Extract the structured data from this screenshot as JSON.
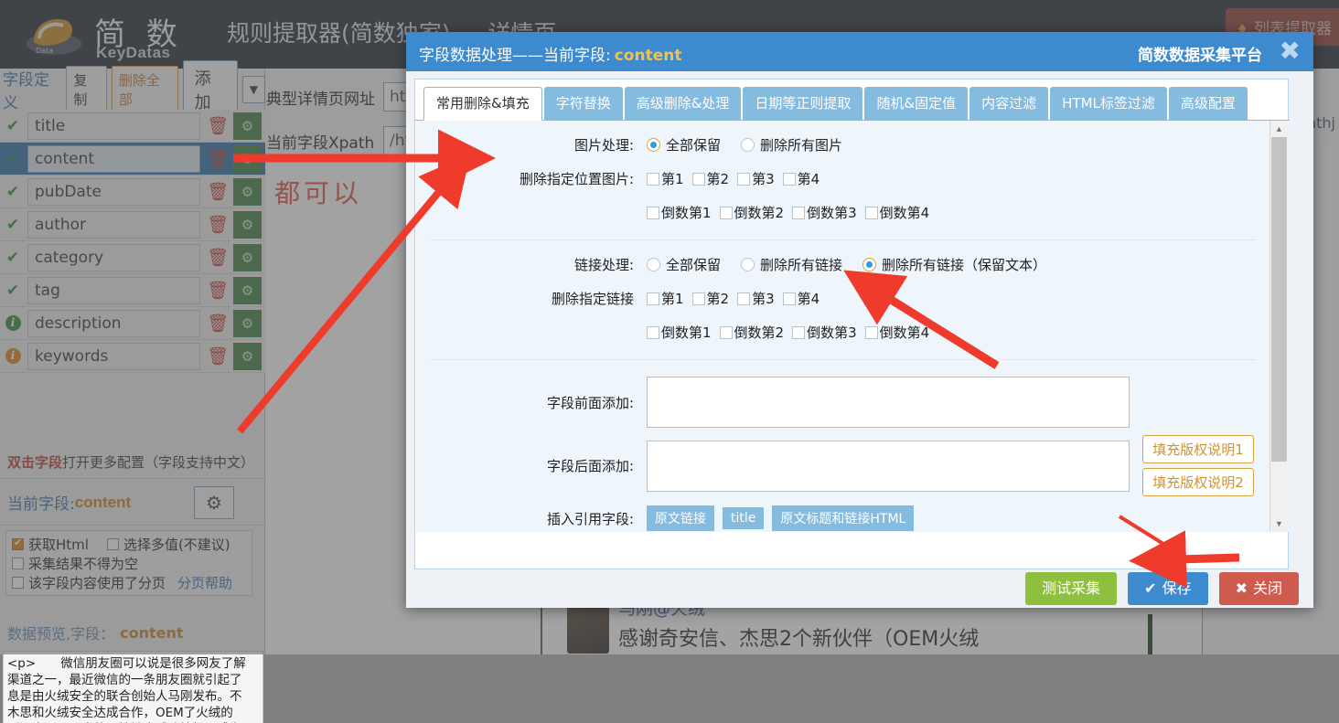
{
  "app": {
    "logo_cn": "简 数",
    "logo_en": "KeyDatas",
    "title": "规则提取器(简数独家) — 详情页",
    "list_extractor_button": "列表提取器",
    "flame_icon": "flame-icon"
  },
  "left_panel": {
    "toolbar": {
      "label": "字段定义",
      "copy": "复制",
      "delete_all": "删除全部",
      "add": "添加",
      "caret": "▼"
    },
    "fields": [
      {
        "state": "ok",
        "name": "title",
        "selected": false
      },
      {
        "state": "ok",
        "name": "content",
        "selected": true
      },
      {
        "state": "ok",
        "name": "pubDate",
        "selected": false
      },
      {
        "state": "ok",
        "name": "author",
        "selected": false
      },
      {
        "state": "ok",
        "name": "category",
        "selected": false
      },
      {
        "state": "ok",
        "name": "tag",
        "selected": false
      },
      {
        "state": "info_green",
        "name": "description",
        "selected": false
      },
      {
        "state": "info_orange",
        "name": "keywords",
        "selected": false
      }
    ],
    "row_icons": {
      "trash": "trash-icon",
      "gear": "gear-icon"
    },
    "dblclick_hint_red": "双击字段",
    "dblclick_hint_rest": "打开更多配置（字段支持中文）",
    "current_field_label": "当前字段:",
    "current_field_value": "content",
    "current_field_gear": "gear-icon",
    "options": {
      "get_html": "获取Html",
      "get_html_checked": true,
      "multi_value": "选择多值(不建议)",
      "multi_value_checked": false,
      "not_empty": "采集结果不得为空",
      "not_empty_checked": false,
      "paging": "该字段内容使用了分页",
      "paging_checked": false,
      "paging_help": "分页帮助"
    },
    "preview_label": "数据预览,字段：",
    "preview_field": "content",
    "preview_text": "<p>　　微信朋友圈可以说是很多网友了解\n渠道之一，最近微信的一条朋友圈就引起了\n息是由火绒安全的联合创始人马刚发布。不\n木思和火绒安全达成合作，OEM了火绒的\n刚还表示下一步将开始输出威胁情报，成为"
  },
  "background_form": {
    "url_label": "典型详情页网址",
    "url_value": "http://",
    "xpath_label": "当前字段Xpath",
    "xpath_value": "/html/b",
    "annotation_text": "都可以",
    "right_label": "oathj",
    "article_author": "马刚@火绒",
    "article_headline": "感谢奇安信、杰思2个新伙伴（OEM火绒"
  },
  "dialog": {
    "title_prefix": "字段数据处理——当前字段",
    "title_sep": ":",
    "title_field": "content",
    "brand": "简数数据采集平台",
    "close_icon": "close-icon",
    "tabs": [
      {
        "label": "常用删除&填充",
        "active": true
      },
      {
        "label": "字符替换",
        "active": false
      },
      {
        "label": "高级删除&处理",
        "active": false
      },
      {
        "label": "日期等正则提取",
        "active": false
      },
      {
        "label": "随机&固定值",
        "active": false
      },
      {
        "label": "内容过滤",
        "active": false
      },
      {
        "label": "HTML标签过滤",
        "active": false
      },
      {
        "label": "高级配置",
        "active": false
      }
    ],
    "form": {
      "image_handling_label": "图片处理:",
      "image_options": [
        {
          "label": "全部保留",
          "checked": true
        },
        {
          "label": "删除所有图片",
          "checked": false
        }
      ],
      "delete_image_pos_label": "删除指定位置图片:",
      "pos_forward": [
        "第1",
        "第2",
        "第3",
        "第4"
      ],
      "pos_backward": [
        "倒数第1",
        "倒数第2",
        "倒数第3",
        "倒数第4"
      ],
      "link_handling_label": "链接处理:",
      "link_options": [
        {
          "label": "全部保留",
          "checked": false
        },
        {
          "label": "删除所有链接",
          "checked": false
        },
        {
          "label": "删除所有链接（保留文本）",
          "checked": true
        }
      ],
      "delete_link_pos_label": "删除指定链接",
      "link_pos_forward": [
        "第1",
        "第2",
        "第3",
        "第4"
      ],
      "link_pos_backward": [
        "倒数第1",
        "倒数第2",
        "倒数第3",
        "倒数第4"
      ],
      "prefix_label": "字段前面添加:",
      "prefix_value": "",
      "suffix_label": "字段后面添加:",
      "suffix_value": "",
      "copyright_btn_1": "填充版权说明1",
      "copyright_btn_2": "填充版权说明2",
      "insert_ref_label": "插入引用字段:",
      "ref_buttons": [
        "原文链接",
        "title",
        "原文标题和链接HTML"
      ]
    },
    "scrollbar": {
      "up": "▲",
      "down": "▼"
    },
    "footer": {
      "test": "测试采集",
      "save": "保存",
      "save_icon": "check-icon",
      "close": "关闭",
      "close_icon": "cross-icon"
    }
  }
}
